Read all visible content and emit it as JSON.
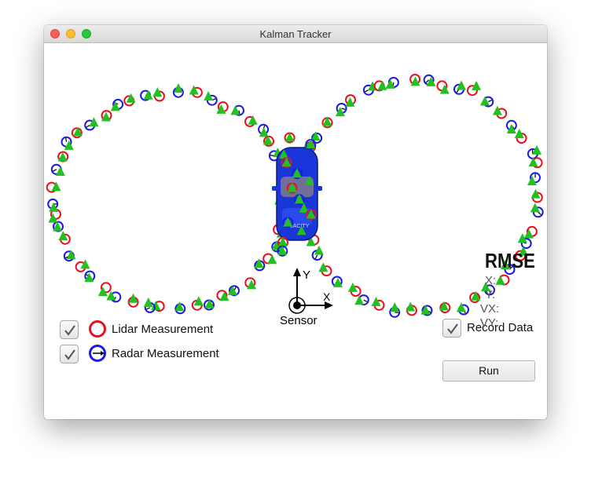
{
  "window": {
    "title": "Kalman Tracker"
  },
  "legend": {
    "lidar_label": "Lidar Measurement",
    "radar_label": "Radar Measurement",
    "lidar_checked": true,
    "radar_checked": true
  },
  "controls": {
    "record_label": "Record Data",
    "record_checked": true,
    "run_label": "Run"
  },
  "rmse": {
    "title": "RMSE",
    "x_label": "X:",
    "y_label": "Y:",
    "vx_label": "VX:",
    "vy_label": "VY:"
  },
  "sensor": {
    "label": "Sensor",
    "axis_x": "X",
    "axis_y": "Y"
  },
  "car": {
    "badge": "UDACITY"
  },
  "colors": {
    "lidar": "#e8101c",
    "radar": "#1a1ae6",
    "estimate": "#22c020",
    "car": "#1b36d8"
  },
  "icons": {
    "lidar": "red-ring-icon",
    "radar": "blue-ring-arrow-icon",
    "estimate": "green-triangle-icon",
    "checkbox": "checkmark-icon"
  }
}
